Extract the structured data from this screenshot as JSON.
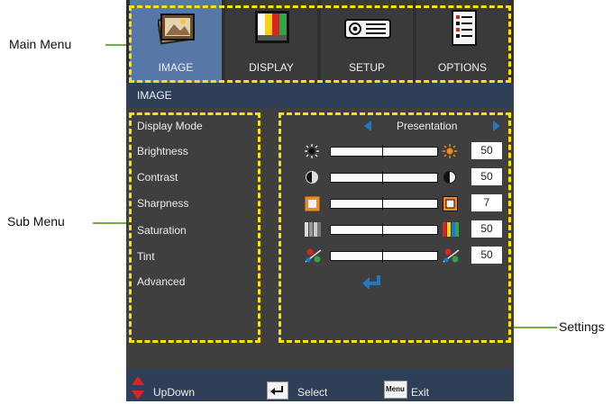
{
  "callouts": {
    "main_menu": "Main Menu",
    "sub_menu": "Sub Menu",
    "settings": "Settings"
  },
  "header": {
    "breadcrumb": "IMAGE"
  },
  "tabs": [
    {
      "label": "IMAGE",
      "icon": "image-icon",
      "active": true
    },
    {
      "label": "DISPLAY",
      "icon": "color-bars-icon",
      "active": false
    },
    {
      "label": "SETUP",
      "icon": "projector-icon",
      "active": false
    },
    {
      "label": "OPTIONS",
      "icon": "options-list-icon",
      "active": false
    }
  ],
  "submenu": {
    "items": [
      {
        "label": "Display Mode"
      },
      {
        "label": "Brightness",
        "value": "50"
      },
      {
        "label": "Contrast",
        "value": "50"
      },
      {
        "label": "Sharpness",
        "value": "7"
      },
      {
        "label": "Saturation",
        "value": "50"
      },
      {
        "label": "Tint",
        "value": "50"
      },
      {
        "label": "Advanced"
      }
    ],
    "display_mode_value": "Presentation"
  },
  "footer": {
    "updown": "UpDown",
    "select": "Select",
    "exit": "Exit",
    "menu_key": "Menu"
  },
  "colors": {
    "active_tab": "#5778a6",
    "dash": "#ffe100",
    "callout_green": "#7dc242",
    "arrow_blue": "#1f79c4"
  }
}
